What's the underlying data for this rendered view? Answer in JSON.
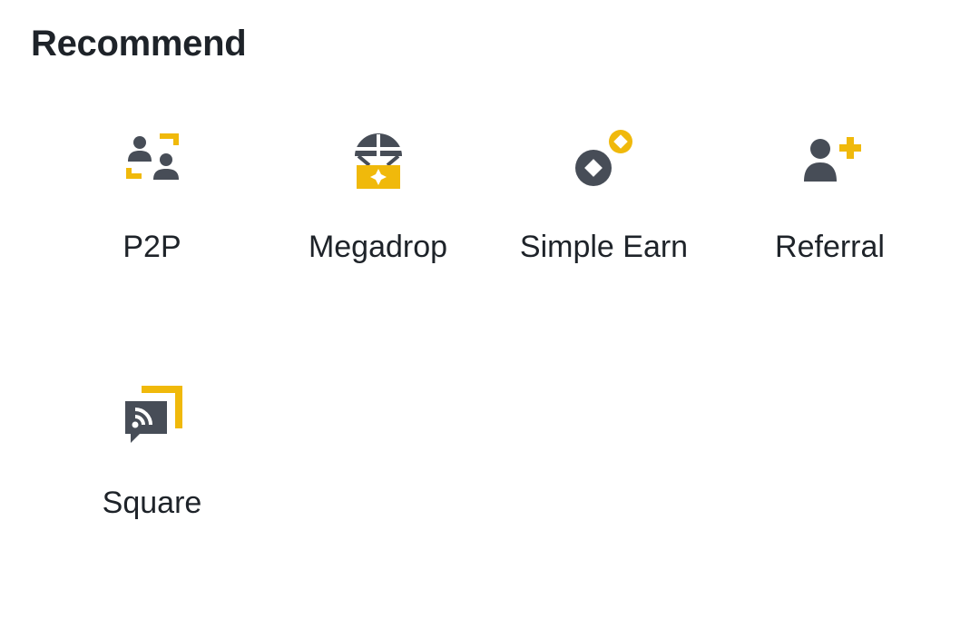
{
  "section": {
    "title": "Recommend"
  },
  "colors": {
    "text": "#1e2329",
    "icon_dark": "#474d57",
    "icon_accent": "#f0b90b",
    "background": "#ffffff"
  },
  "tiles": [
    {
      "label": "P2P",
      "icon": "p2p-icon"
    },
    {
      "label": "Megadrop",
      "icon": "megadrop-icon"
    },
    {
      "label": "Simple Earn",
      "icon": "simple-earn-icon"
    },
    {
      "label": "Referral",
      "icon": "referral-icon"
    },
    {
      "label": "Square",
      "icon": "square-icon"
    }
  ]
}
